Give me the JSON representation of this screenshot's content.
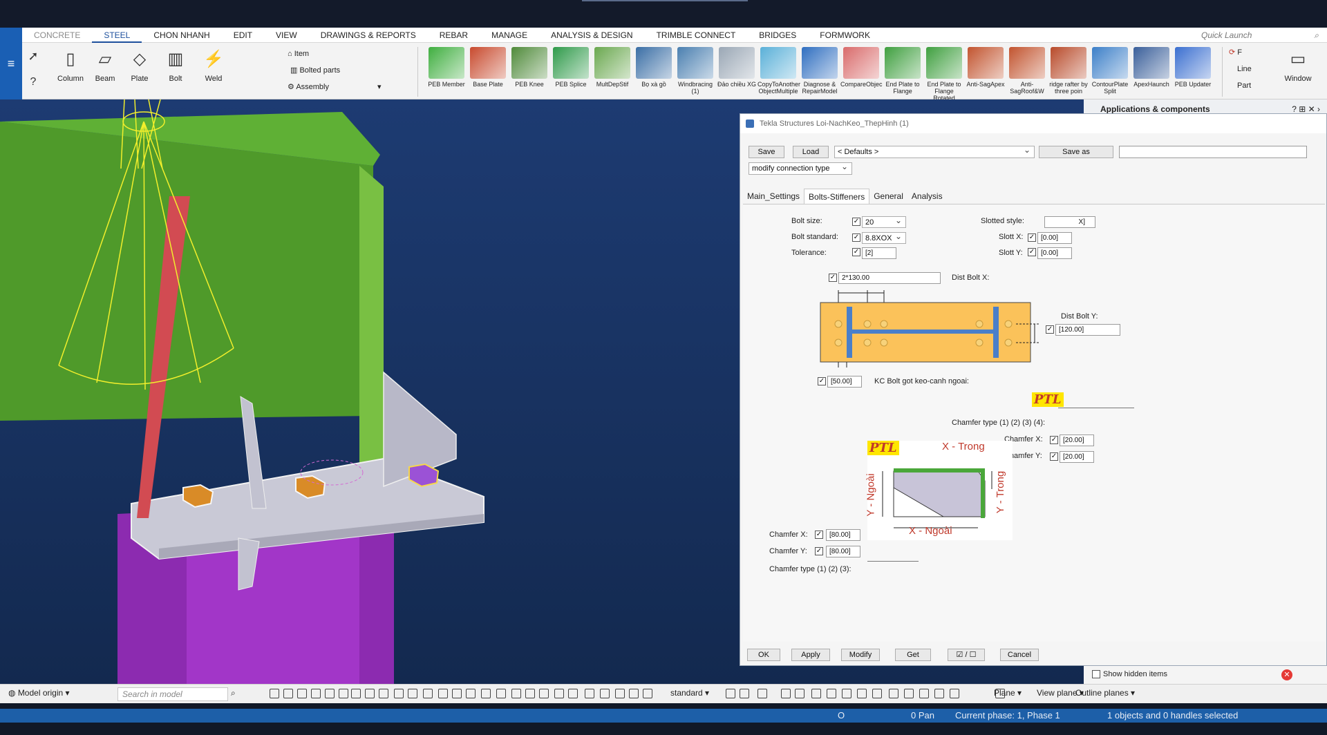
{
  "ribbon_tabs": [
    "CONCRETE",
    "STEEL",
    "CHON NHANH",
    "EDIT",
    "VIEW",
    "DRAWINGS & REPORTS",
    "REBAR",
    "MANAGE",
    "ANALYSIS & DESIGN",
    "TRIMBLE CONNECT",
    "BRIDGES",
    "FORMWORK"
  ],
  "quick_launch": "Quick Launch",
  "ribbon": {
    "column": "Column",
    "beam": "Beam",
    "plate": "Plate",
    "bolt": "Bolt",
    "weld": "Weld",
    "item": "Item",
    "bolted_parts": "Bolted parts",
    "assembly": "Assembly",
    "window": "Window",
    "line": "Line",
    "part": "Part",
    "f_label": "F"
  },
  "components": [
    {
      "label": "PEB Member",
      "color": "#3fae3f"
    },
    {
      "label": "Base Plate",
      "color": "#c84a2e"
    },
    {
      "label": "PEB Knee",
      "color": "#4f8a3a"
    },
    {
      "label": "PEB Splice",
      "color": "#2f9a4a"
    },
    {
      "label": "MultDepStif",
      "color": "#6aa84f"
    },
    {
      "label": "Bọ xà gồ",
      "color": "#3a6ea5"
    },
    {
      "label": "Windbracing (1)",
      "color": "#4a7fb0"
    },
    {
      "label": "Đảo chiều XG",
      "color": "#9aa7b5"
    },
    {
      "label": "CopyToAnother ObjectMultiple",
      "color": "#5ab0d8"
    },
    {
      "label": "Diagnose & RepairModel",
      "color": "#2f6ec0"
    },
    {
      "label": "CompareObjec",
      "color": "#d96b6b"
    },
    {
      "label": "End Plate to Flange",
      "color": "#3f9f3f"
    },
    {
      "label": "End Plate to Flange Rotated",
      "color": "#3f9f3f"
    },
    {
      "label": "Anti-SagApex",
      "color": "#c2542f"
    },
    {
      "label": "Anti-SagRoof&W",
      "color": "#c2542f"
    },
    {
      "label": "ridge rafter by three poin",
      "color": "#b84a2a"
    },
    {
      "label": "ContourPlate Split",
      "color": "#3c7fc8"
    },
    {
      "label": "ApexHaunch",
      "color": "#3a5f9a"
    },
    {
      "label": "PEB Updater",
      "color": "#3b6fd0"
    }
  ],
  "app_panel": {
    "title": "Applications & components",
    "show_hidden": "Show hidden items"
  },
  "dialog": {
    "title": "Tekla Structures  Loi-NachKeo_ThepHinh (1)",
    "save": "Save",
    "load": "Load",
    "defaults": "< Defaults >",
    "save_as": "Save as",
    "modify_type": "modify connection type",
    "tabs": [
      "Main_Settings",
      "Bolts-Stiffeners",
      "General",
      "Analysis"
    ],
    "active_tab": 1,
    "bolt_size_label": "Bolt size:",
    "bolt_size": "20",
    "bolt_standard_label": "Bolt standard:",
    "bolt_standard": "8.8XOX",
    "tolerance_label": "Tolerance:",
    "tolerance": "[2]",
    "slotted_style_label": "Slotted style:",
    "slotted_style": "X]",
    "slott_x_label": "Slott X:",
    "slott_x": "[0.00]",
    "slott_y_label": "Slott Y:",
    "slott_y": "[0.00]",
    "dist_bolt_x_value": "2*130.00",
    "dist_bolt_x_label": "Dist Bolt X:",
    "dist_bolt_y_label": "Dist Bolt Y:",
    "dist_bolt_y_value": "[120.00]",
    "kc_value": "[50.00]",
    "kc_label": "KC Bolt got keo-canh ngoai:",
    "ptl": "PTL",
    "chamfer_type_right": "Chamfer type  (1) (2) (3) (4):",
    "chamfer_x_label": "Chamfer X:",
    "chamfer_x_right": "[20.00]",
    "chamfer_y_label": "Chamfer Y:",
    "chamfer_y_right": "[20.00]",
    "x_trong": "X - Trong",
    "y_trong": "Y - Trong",
    "y_ngoai": "Y - Ngoài",
    "x_ngoai": "X - Ngoài",
    "chamfer_x_left": "[80.00]",
    "chamfer_y_left": "[80.00]",
    "chamfer_type_left": "Chamfer type  (1) (2) (3):",
    "ok": "OK",
    "apply": "Apply",
    "modify": "Modify",
    "get": "Get",
    "toggle": "☑ / ☐",
    "cancel": "Cancel"
  },
  "bottom": {
    "model_origin": "Model origin",
    "search": "Search in model",
    "standard": "standard",
    "plane": "Plane",
    "view_plane": "View plane",
    "outline_planes": "Outline planes"
  },
  "status": {
    "o": "O",
    "pan": "0  Pan",
    "phase": "Current phase: 1, Phase 1",
    "selected": "1 objects and 0 handles selected"
  },
  "colors": {
    "accent": "#1c4f9c",
    "model_green": "#4e9a2b",
    "model_purple": "#8e2bb0",
    "plate_yellow": "#fbc25a"
  }
}
